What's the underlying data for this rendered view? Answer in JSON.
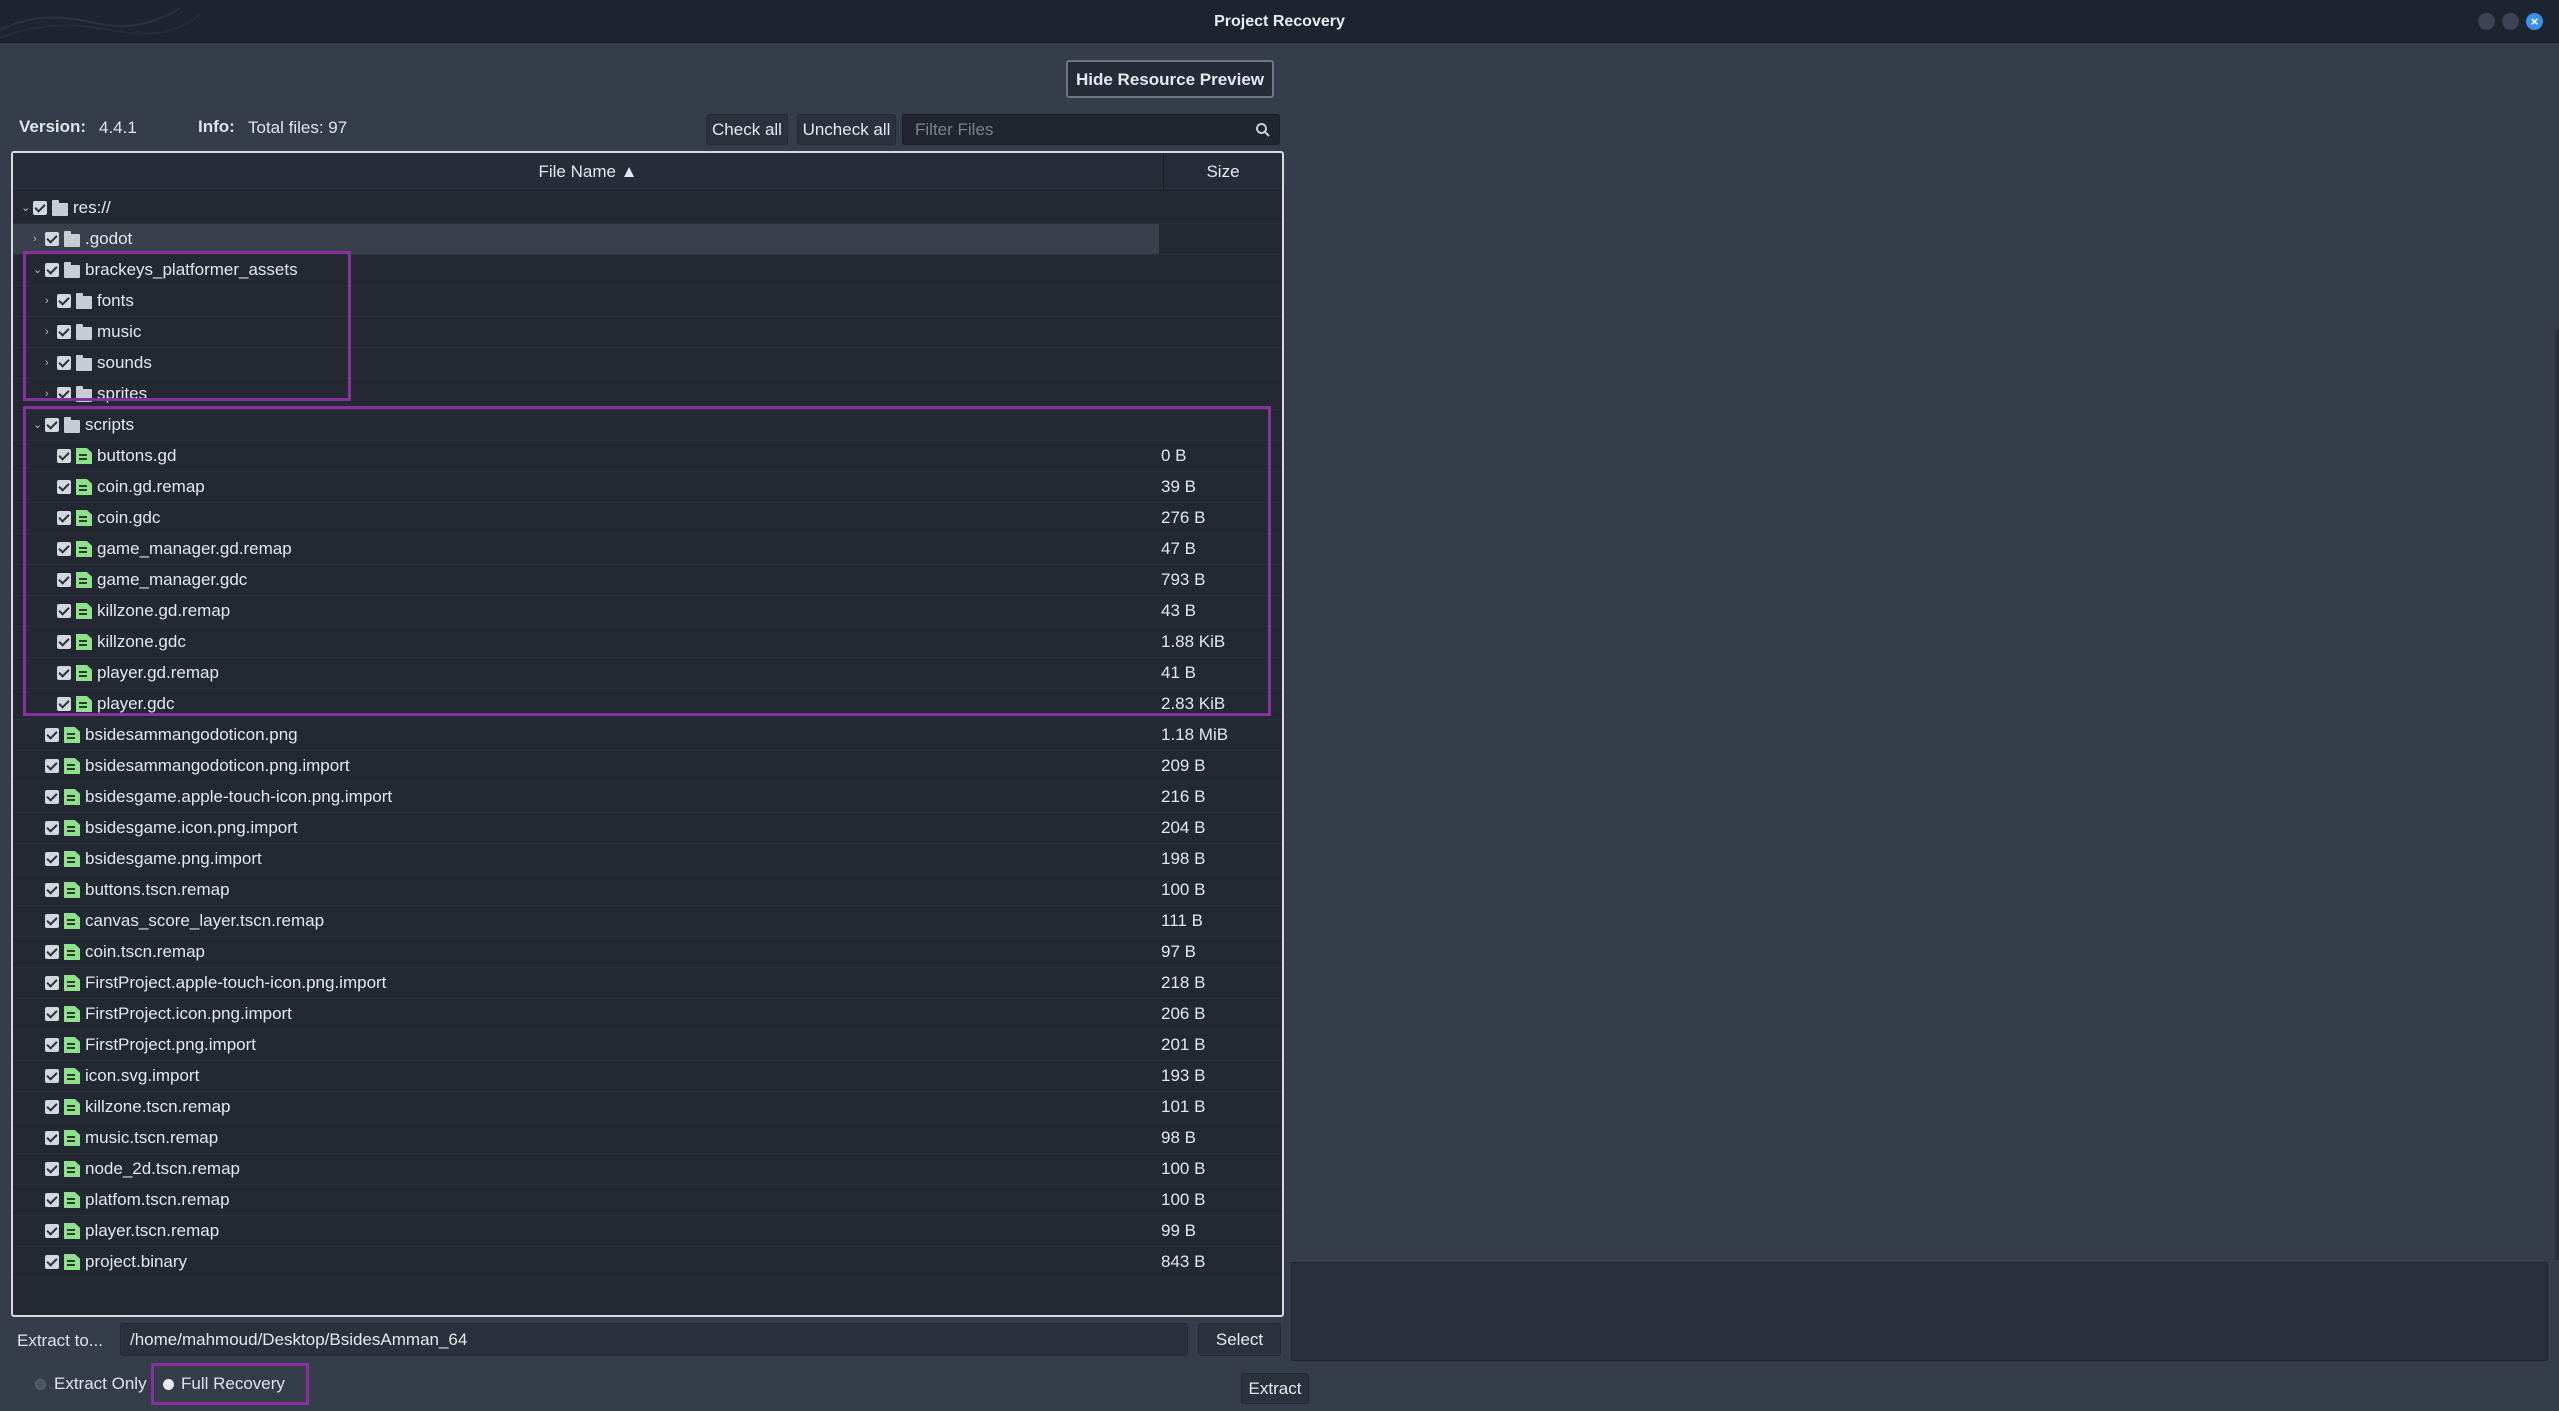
{
  "window": {
    "title": "Project Recovery"
  },
  "toolbar": {
    "hide_preview_label": "Hide Resource Preview",
    "check_all_label": "Check all",
    "uncheck_all_label": "Uncheck all",
    "filter_placeholder": "Filter Files"
  },
  "info": {
    "version_label": "Version:",
    "version_value": "4.4.1",
    "info_label": "Info:",
    "info_value": "Total files: 97"
  },
  "tree": {
    "columns": {
      "name": "File Name ▲",
      "size": "Size"
    },
    "rows": [
      {
        "name": "res://",
        "size": "",
        "type": "folder",
        "depth": 0,
        "expanded": true,
        "checked": true
      },
      {
        "name": ".godot",
        "size": "",
        "type": "folder",
        "depth": 1,
        "expanded": false,
        "checked": true,
        "highlighted": true
      },
      {
        "name": "brackeys_platformer_assets",
        "size": "",
        "type": "folder",
        "depth": 1,
        "expanded": true,
        "checked": true
      },
      {
        "name": "fonts",
        "size": "",
        "type": "folder",
        "depth": 2,
        "expanded": false,
        "checked": true
      },
      {
        "name": "music",
        "size": "",
        "type": "folder",
        "depth": 2,
        "expanded": false,
        "checked": true
      },
      {
        "name": "sounds",
        "size": "",
        "type": "folder",
        "depth": 2,
        "expanded": false,
        "checked": true
      },
      {
        "name": "sprites",
        "size": "",
        "type": "folder",
        "depth": 2,
        "expanded": false,
        "checked": true
      },
      {
        "name": "scripts",
        "size": "",
        "type": "folder",
        "depth": 1,
        "expanded": true,
        "checked": true
      },
      {
        "name": "buttons.gd",
        "size": "0 B",
        "type": "file",
        "depth": 2,
        "checked": true
      },
      {
        "name": "coin.gd.remap",
        "size": "39 B",
        "type": "file",
        "depth": 2,
        "checked": true
      },
      {
        "name": "coin.gdc",
        "size": "276 B",
        "type": "file",
        "depth": 2,
        "checked": true
      },
      {
        "name": "game_manager.gd.remap",
        "size": "47 B",
        "type": "file",
        "depth": 2,
        "checked": true
      },
      {
        "name": "game_manager.gdc",
        "size": "793 B",
        "type": "file",
        "depth": 2,
        "checked": true
      },
      {
        "name": "killzone.gd.remap",
        "size": "43 B",
        "type": "file",
        "depth": 2,
        "checked": true
      },
      {
        "name": "killzone.gdc",
        "size": "1.88 KiB",
        "type": "file",
        "depth": 2,
        "checked": true
      },
      {
        "name": "player.gd.remap",
        "size": "41 B",
        "type": "file",
        "depth": 2,
        "checked": true
      },
      {
        "name": "player.gdc",
        "size": "2.83 KiB",
        "type": "file",
        "depth": 2,
        "checked": true
      },
      {
        "name": "bsidesammangodoticon.png",
        "size": "1.18 MiB",
        "type": "file",
        "depth": 1,
        "checked": true
      },
      {
        "name": "bsidesammangodoticon.png.import",
        "size": "209 B",
        "type": "file",
        "depth": 1,
        "checked": true
      },
      {
        "name": "bsidesgame.apple-touch-icon.png.import",
        "size": "216 B",
        "type": "file",
        "depth": 1,
        "checked": true
      },
      {
        "name": "bsidesgame.icon.png.import",
        "size": "204 B",
        "type": "file",
        "depth": 1,
        "checked": true
      },
      {
        "name": "bsidesgame.png.import",
        "size": "198 B",
        "type": "file",
        "depth": 1,
        "checked": true
      },
      {
        "name": "buttons.tscn.remap",
        "size": "100 B",
        "type": "file",
        "depth": 1,
        "checked": true
      },
      {
        "name": "canvas_score_layer.tscn.remap",
        "size": "111 B",
        "type": "file",
        "depth": 1,
        "checked": true
      },
      {
        "name": "coin.tscn.remap",
        "size": "97 B",
        "type": "file",
        "depth": 1,
        "checked": true
      },
      {
        "name": "FirstProject.apple-touch-icon.png.import",
        "size": "218 B",
        "type": "file",
        "depth": 1,
        "checked": true
      },
      {
        "name": "FirstProject.icon.png.import",
        "size": "206 B",
        "type": "file",
        "depth": 1,
        "checked": true
      },
      {
        "name": "FirstProject.png.import",
        "size": "201 B",
        "type": "file",
        "depth": 1,
        "checked": true
      },
      {
        "name": "icon.svg.import",
        "size": "193 B",
        "type": "file",
        "depth": 1,
        "checked": true
      },
      {
        "name": "killzone.tscn.remap",
        "size": "101 B",
        "type": "file",
        "depth": 1,
        "checked": true
      },
      {
        "name": "music.tscn.remap",
        "size": "98 B",
        "type": "file",
        "depth": 1,
        "checked": true
      },
      {
        "name": "node_2d.tscn.remap",
        "size": "100 B",
        "type": "file",
        "depth": 1,
        "checked": true
      },
      {
        "name": "platfom.tscn.remap",
        "size": "100 B",
        "type": "file",
        "depth": 1,
        "checked": true
      },
      {
        "name": "player.tscn.remap",
        "size": "99 B",
        "type": "file",
        "depth": 1,
        "checked": true
      },
      {
        "name": "project.binary",
        "size": "843 B",
        "type": "file",
        "depth": 1,
        "checked": true
      }
    ]
  },
  "extract": {
    "label": "Extract to...",
    "path": "/home/mahmoud/Desktop/BsidesAmman_64",
    "select_label": "Select",
    "mode_extract_only": "Extract Only",
    "mode_full_recovery": "Full Recovery",
    "selected_mode": "Full Recovery",
    "extract_label": "Extract"
  },
  "colors": {
    "background": "#363d4a",
    "titlebar": "#1e2330",
    "highlight_box": "#8a2f9e",
    "file_icon": "#8ee08a",
    "close_button": "#3d8fe8"
  }
}
